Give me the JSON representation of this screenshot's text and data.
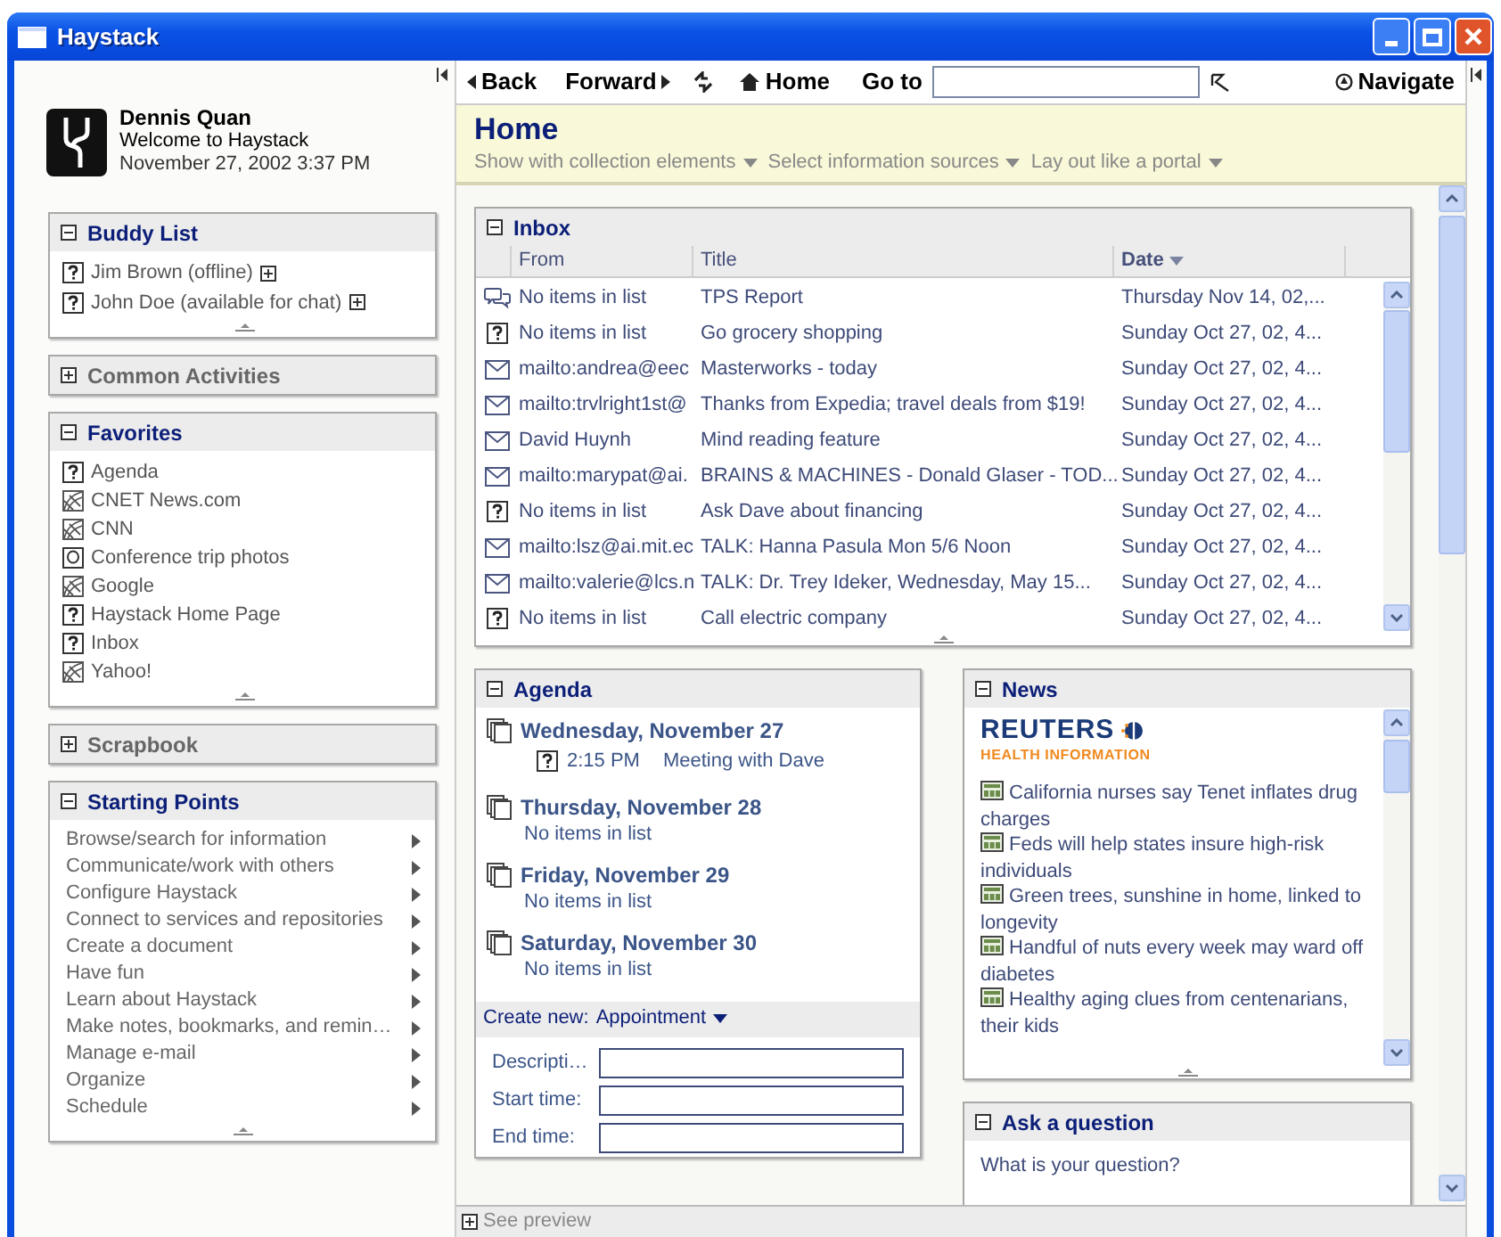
{
  "window": {
    "title": "Haystack"
  },
  "user": {
    "name": "Dennis Quan",
    "welcome": "Welcome to Haystack",
    "datetime": "November 27, 2002 3:37 PM"
  },
  "sidebar_panels": [
    {
      "title": "Buddy List",
      "expanded": true,
      "kind": "buddies",
      "items": [
        {
          "label": "Jim Brown (offline)"
        },
        {
          "label": "John Doe (available for chat)"
        }
      ]
    },
    {
      "title": "Common Activities",
      "expanded": false
    },
    {
      "title": "Favorites",
      "expanded": true,
      "kind": "favorites",
      "items": [
        {
          "label": "Agenda",
          "kind": "unknown"
        },
        {
          "label": "CNET News.com",
          "kind": "web"
        },
        {
          "label": "CNN",
          "kind": "web"
        },
        {
          "label": "Conference trip photos",
          "kind": "photo"
        },
        {
          "label": "Google",
          "kind": "web"
        },
        {
          "label": "Haystack Home Page",
          "kind": "unknown"
        },
        {
          "label": "Inbox",
          "kind": "unknown"
        },
        {
          "label": "Yahoo!",
          "kind": "web"
        }
      ]
    },
    {
      "title": "Scrapbook",
      "expanded": false
    },
    {
      "title": "Starting Points",
      "expanded": true,
      "kind": "menu",
      "items": [
        {
          "label": "Browse/search for information"
        },
        {
          "label": "Communicate/work with others"
        },
        {
          "label": "Configure Haystack"
        },
        {
          "label": "Connect to services and repositories"
        },
        {
          "label": "Create a document"
        },
        {
          "label": "Have fun"
        },
        {
          "label": "Learn about Haystack"
        },
        {
          "label": "Make notes, bookmarks, and remin…"
        },
        {
          "label": "Manage e-mail"
        },
        {
          "label": "Organize"
        },
        {
          "label": "Schedule"
        }
      ]
    }
  ],
  "toolbar": {
    "back": "Back",
    "forward": "Forward",
    "home": "Home",
    "goto_label": "Go to",
    "navigate": "Navigate"
  },
  "page_header": {
    "title": "Home",
    "options": [
      "Show with collection elements",
      "Select information sources",
      "Lay out like a portal"
    ]
  },
  "inbox": {
    "title": "Inbox",
    "expanded": true,
    "columns": [
      {
        "label": "From",
        "sorted": false
      },
      {
        "label": "Title",
        "sorted": false
      },
      {
        "label": "Date",
        "sorted": true
      }
    ],
    "rows": [
      {
        "kind": "chat",
        "from": "No items in list",
        "title": "TPS Report",
        "date": "Thursday Nov 14, 02,..."
      },
      {
        "kind": "unknown",
        "from": "No items in list",
        "title": "Go grocery shopping",
        "date": "Sunday Oct 27, 02, 4..."
      },
      {
        "kind": "mail",
        "from": "mailto:andrea@eec",
        "title": "Masterworks - today",
        "date": "Sunday Oct 27, 02, 4..."
      },
      {
        "kind": "mail",
        "from": "mailto:trvlright1st@",
        "title": "Thanks from Expedia; travel deals from $19!",
        "date": "Sunday Oct 27, 02, 4..."
      },
      {
        "kind": "mail",
        "from": "David Huynh",
        "title": "Mind reading feature",
        "date": "Sunday Oct 27, 02, 4..."
      },
      {
        "kind": "mail",
        "from": "mailto:marypat@ai.",
        "title": "BRAINS & MACHINES - Donald Glaser - TOD...",
        "date": "Sunday Oct 27, 02, 4..."
      },
      {
        "kind": "unknown",
        "from": "No items in list",
        "title": "Ask Dave about financing",
        "date": "Sunday Oct 27, 02, 4..."
      },
      {
        "kind": "mail",
        "from": "mailto:lsz@ai.mit.ec",
        "title": "TALK: Hanna Pasula Mon 5/6 Noon",
        "date": "Sunday Oct 27, 02, 4..."
      },
      {
        "kind": "mail",
        "from": "mailto:valerie@lcs.n",
        "title": "TALK: Dr. Trey Ideker, Wednesday, May 15...",
        "date": "Sunday Oct 27, 02, 4..."
      },
      {
        "kind": "unknown",
        "from": "No items in list",
        "title": "Call electric company",
        "date": "Sunday Oct 27, 02, 4..."
      }
    ]
  },
  "agenda": {
    "title": "Agenda",
    "expanded": true,
    "days": [
      {
        "title": "Wednesday, November 27",
        "items": [
          {
            "time": "2:15 PM",
            "text": "Meeting with Dave"
          }
        ]
      },
      {
        "title": "Thursday, November 28",
        "note": "No items in list"
      },
      {
        "title": "Friday, November 29",
        "note": "No items in list"
      },
      {
        "title": "Saturday, November 30",
        "note": "No items in list"
      }
    ],
    "create_label": "Create new:",
    "create_value": "Appointment",
    "fields": [
      {
        "label": "Descripti…"
      },
      {
        "label": "Start time:"
      },
      {
        "label": "End time:"
      }
    ]
  },
  "news": {
    "title": "News",
    "expanded": true,
    "logo": "REUTERS",
    "logo_sub": "HEALTH INFORMATION",
    "items": [
      "California nurses say Tenet inflates drug charges",
      "Feds will help states insure high-risk individuals",
      "Green trees, sunshine in home, linked to longevity",
      "Handful of nuts every week may ward off diabetes",
      "Healthy aging clues from centenarians, their kids"
    ]
  },
  "ask": {
    "title": "Ask a question",
    "expanded": true,
    "prompt": "What is your question?"
  },
  "status_bar": {
    "preview": "See preview",
    "expanded": false
  }
}
